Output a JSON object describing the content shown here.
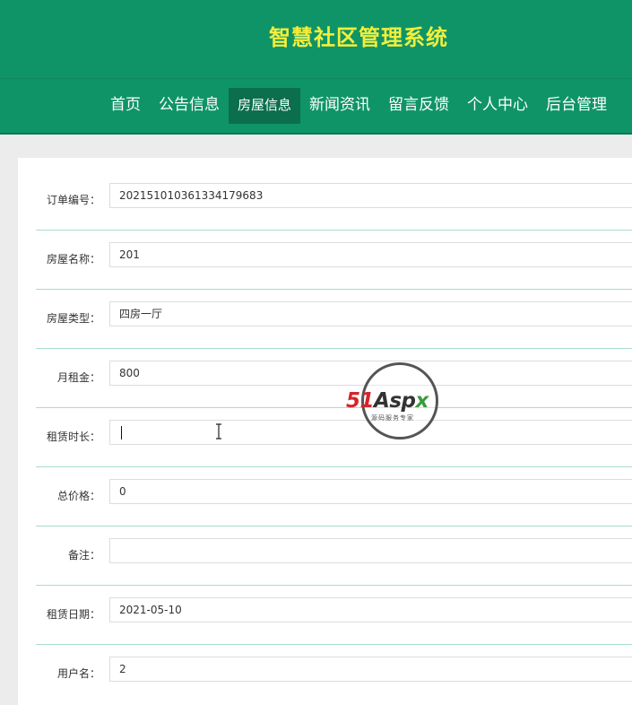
{
  "header": {
    "title": "智慧社区管理系统",
    "nav": [
      {
        "label": "首页",
        "active": false
      },
      {
        "label": "公告信息",
        "active": false
      },
      {
        "label": "房屋信息",
        "active": true
      },
      {
        "label": "新闻资讯",
        "active": false
      },
      {
        "label": "留言反馈",
        "active": false
      },
      {
        "label": "个人中心",
        "active": false
      },
      {
        "label": "后台管理",
        "active": false
      }
    ]
  },
  "form": {
    "fields": [
      {
        "label": "订单编号：",
        "value": "20215101036133417968​3"
      },
      {
        "label": "房屋名称：",
        "value": "201"
      },
      {
        "label": "房屋类型：",
        "value": "四房一厅"
      },
      {
        "label": "月租金：",
        "value": "800"
      },
      {
        "label": "租赁时长：",
        "value": ""
      },
      {
        "label": "总价格：",
        "value": "0"
      },
      {
        "label": "备注：",
        "value": ""
      },
      {
        "label": "租赁日期：",
        "value": "2021-05-10"
      },
      {
        "label": "用户名：",
        "value": "2"
      }
    ]
  },
  "watermark": {
    "logo_num": "51",
    "logo_a": "Asp",
    "logo_x": "x",
    "subtitle": "源码服务专家"
  },
  "colors": {
    "header_bg": "#0f9467",
    "title": "#f3ee3c",
    "nav_active_bg": "#0b6e4c",
    "row_divider": "#a9dcc6"
  }
}
